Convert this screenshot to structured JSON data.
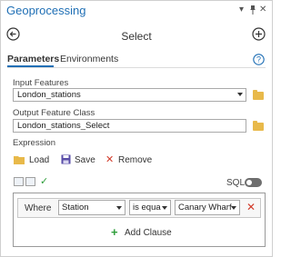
{
  "pane": {
    "title": "Geoprocessing"
  },
  "window_controls": {
    "dropdown": "▾",
    "pin": "⊕",
    "close": "✕"
  },
  "header": {
    "tool_title": "Select"
  },
  "tabs": [
    {
      "label": "Parameters",
      "active": true
    },
    {
      "label": "Environments",
      "active": false
    }
  ],
  "parameters": {
    "input_features": {
      "label": "Input Features",
      "value": "London_stations"
    },
    "output_feature_class": {
      "label": "Output Feature Class",
      "value": "London_stations_Select"
    },
    "expression": {
      "label": "Expression"
    }
  },
  "actions": {
    "load": "Load",
    "save": "Save",
    "remove": "Remove"
  },
  "sql": {
    "label": "SQL",
    "enabled": false
  },
  "clause": {
    "connector": "Where",
    "field": "Station",
    "operator": "is equa",
    "value": "Canary Wharf",
    "add_label": "Add Clause"
  },
  "colors": {
    "accent": "#1f6fb5",
    "remove": "#d23b2a",
    "add": "#2e9e3a",
    "check": "#2e9e3a"
  }
}
